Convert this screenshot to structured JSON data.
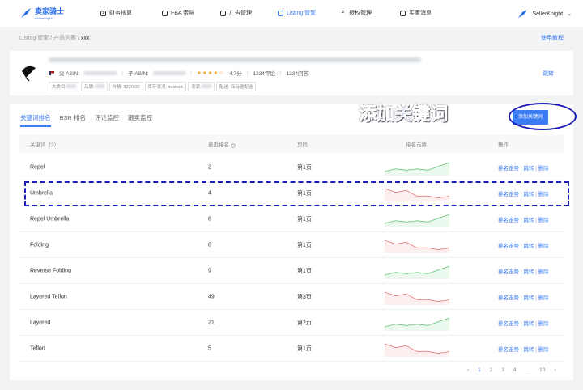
{
  "nav": {
    "logo_title": "卖家骑士",
    "logo_sub": "SellerKnight",
    "items": [
      {
        "label": "财务核算",
        "icon": "dollar-icon"
      },
      {
        "label": "FBA 索赔",
        "icon": "claim-icon"
      },
      {
        "label": "广告管理",
        "icon": "ad-icon"
      },
      {
        "label": "Listing 管家",
        "icon": "listing-icon",
        "active": true
      },
      {
        "label": "授权管理",
        "icon": "auth-icon"
      },
      {
        "label": "买家消息",
        "icon": "message-icon"
      }
    ],
    "user": "SellerKnight"
  },
  "breadcrumb": {
    "items": [
      "Listing 管家",
      "产品列表"
    ],
    "current": "xxx",
    "sep": " / "
  },
  "help_link": "使用教程",
  "product": {
    "parent_asin_label": "父 ASIN:",
    "child_asin_label": "子 ASIN:",
    "rating": "4.7分",
    "stars": "★★★★☆",
    "reviews": "1234评论",
    "qa": "1234问答",
    "tags": {
      "category": "大类目:",
      "brand": "品牌:",
      "price": "价格: $220.00",
      "stock": "库存状况: in stock",
      "seller": "卖家:",
      "delivery": "配送: 亚马逊配送"
    },
    "jump": "跳转"
  },
  "tabs": [
    {
      "label": "关键词排名",
      "active": true
    },
    {
      "label": "BSR 排名"
    },
    {
      "label": "评论监控"
    },
    {
      "label": "跟卖监控"
    }
  ],
  "add_button": "添加关键词",
  "annotation": "添加关键词",
  "table": {
    "headers": [
      "关键词（3）",
      "最近排名",
      "页码",
      "排名走势",
      "操作"
    ],
    "ops": [
      "排名走势",
      "跳转",
      "删除"
    ],
    "rows": [
      {
        "keyword": "Repel",
        "rank": "2",
        "page": "第1页",
        "trend": [
          2,
          4,
          3,
          4,
          3,
          6,
          9
        ]
      },
      {
        "keyword": "Umbrella",
        "rank": "4",
        "page": "第1页",
        "trend": [
          6,
          4,
          5,
          2,
          2,
          1,
          2
        ]
      },
      {
        "keyword": "Repel Umbrella",
        "rank": "6",
        "page": "第1页",
        "trend": [
          2,
          4,
          3,
          4,
          3,
          6,
          9
        ]
      },
      {
        "keyword": "Folding",
        "rank": "8",
        "page": "第1页",
        "trend": [
          6,
          4,
          5,
          2,
          2,
          1,
          2
        ]
      },
      {
        "keyword": "Reverse Folding",
        "rank": "9",
        "page": "第1页",
        "trend": [
          2,
          4,
          3,
          4,
          3,
          6,
          9
        ]
      },
      {
        "keyword": "Layered Teflon",
        "rank": "49",
        "page": "第3页",
        "trend": [
          6,
          4,
          5,
          2,
          2,
          1,
          2
        ]
      },
      {
        "keyword": "Layered",
        "rank": "21",
        "page": "第2页",
        "trend": [
          2,
          4,
          3,
          4,
          3,
          6,
          9
        ]
      },
      {
        "keyword": "Teflon",
        "rank": "5",
        "page": "第1页",
        "trend": [
          6,
          4,
          5,
          2,
          2,
          1,
          2
        ]
      }
    ]
  },
  "colors": {
    "accent": "#3b7cf5",
    "up": "#5cc46e",
    "down": "#e87878"
  },
  "pagination": {
    "prev": "‹",
    "pages": [
      "1",
      "2",
      "3",
      "4",
      "…",
      "10"
    ],
    "next": "›",
    "current": "1"
  }
}
